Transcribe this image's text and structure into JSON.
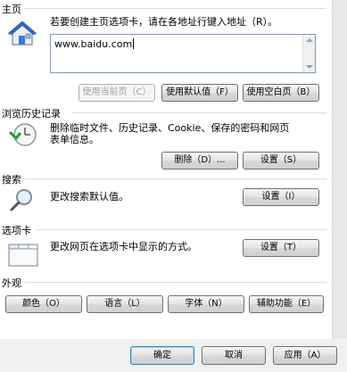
{
  "home": {
    "title": "主页",
    "description": "若要创建主页选项卡，请在各地址行键入地址（R）。",
    "url": "www.baidu.com",
    "btn_current": "使用当前页（C）",
    "btn_default": "使用默认值（F）",
    "btn_blank": "使用空白页（B）"
  },
  "history": {
    "title": "浏览历史记录",
    "description_line1": "删除临时文件、历史记录、Cookie、保存的密码和网页",
    "description_line2": "表单信息。",
    "btn_delete": "删除（D）...",
    "btn_settings": "设置（S）"
  },
  "search": {
    "title": "搜索",
    "description": "更改搜索默认值。",
    "btn_settings": "设置（I）"
  },
  "tabs": {
    "title": "选项卡",
    "description": "更改网页在选项卡中显示的方式。",
    "btn_settings": "设置（T）"
  },
  "appearance": {
    "title": "外观",
    "btn_colors": "颜色（O）",
    "btn_languages": "语言（L）",
    "btn_fonts": "字体（N）",
    "btn_accessibility": "辅助功能（E）"
  },
  "footer": {
    "ok": "确定",
    "cancel": "取消",
    "apply": "应用（A）"
  },
  "icons": {
    "home": "house-icon",
    "history": "clock-history-icon",
    "search": "magnifier-icon",
    "tabs": "tabbed-window-icon"
  }
}
